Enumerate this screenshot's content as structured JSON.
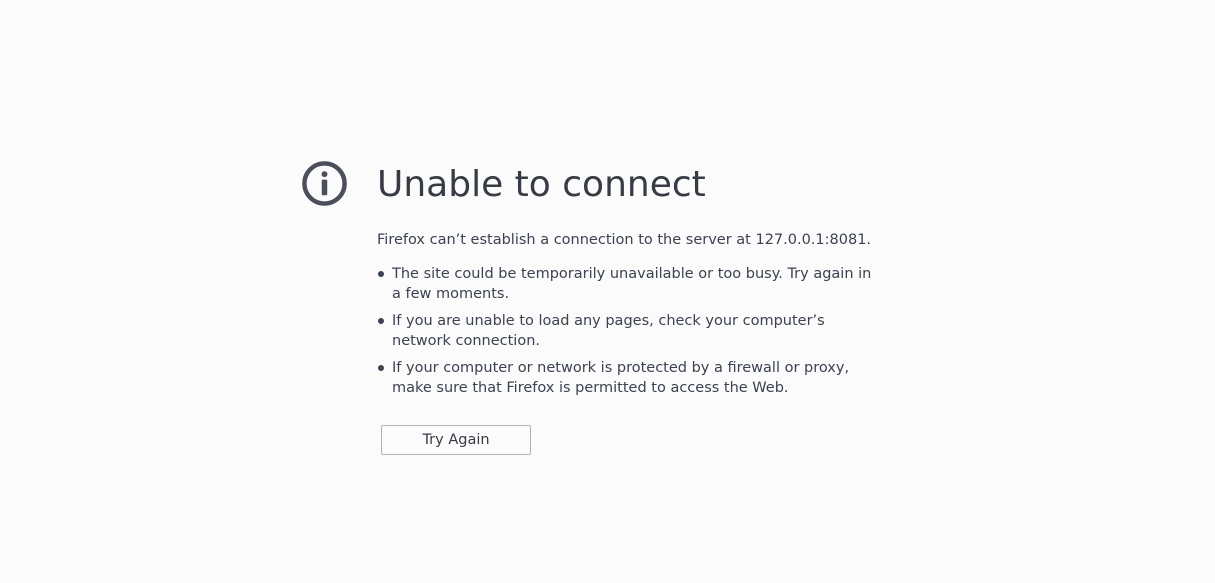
{
  "error": {
    "icon": "info-icon",
    "title": "Unable to connect",
    "description": "Firefox can’t establish a connection to the server at 127.0.0.1:8081.",
    "suggestions": [
      "The site could be temporarily unavailable or too busy. Try again in a few moments.",
      "If you are unable to load any pages, check your computer’s network connection.",
      "If your computer or network is protected by a firewall or proxy, make sure that Firefox is permitted to access the Web."
    ],
    "button_label": "Try Again"
  },
  "colors": {
    "background": "#fbfbfb",
    "text": "#3b4250",
    "icon": "#4a4f59",
    "button_border": "#b1b1b3"
  }
}
